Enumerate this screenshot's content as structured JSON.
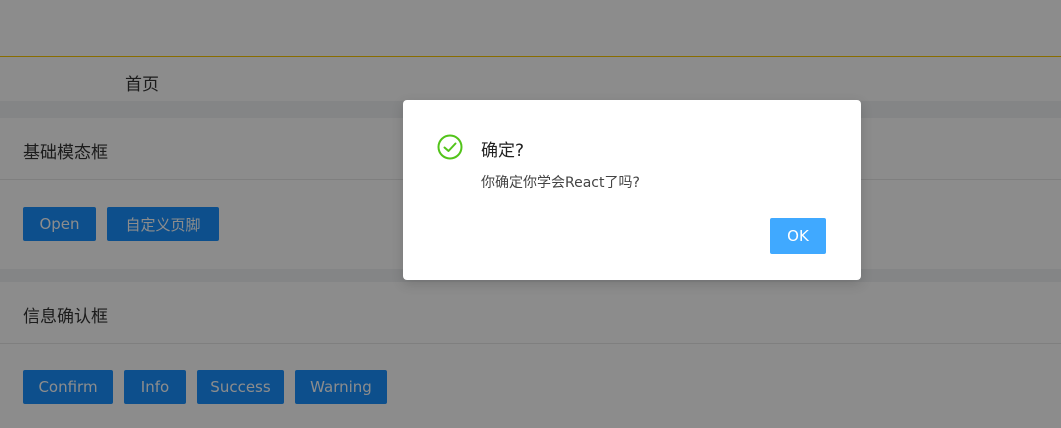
{
  "breadcrumb": {
    "label": "首页"
  },
  "basic_modal_card": {
    "title": "基础模态框",
    "buttons": {
      "open": "Open",
      "custom_footer": "自定义页脚"
    }
  },
  "confirm_card": {
    "title": "信息确认框",
    "buttons": {
      "confirm": "Confirm",
      "info": "Info",
      "success": "Success",
      "warning": "Warning"
    }
  },
  "modal": {
    "icon": "check-circle-icon",
    "title": "确定?",
    "content": "你确定你学会React了吗?",
    "ok_label": "OK"
  },
  "colors": {
    "primary": "#1890ff",
    "ok_button": "#40a9ff",
    "success_icon": "#52c41a",
    "header_accent": "#f9c700"
  }
}
